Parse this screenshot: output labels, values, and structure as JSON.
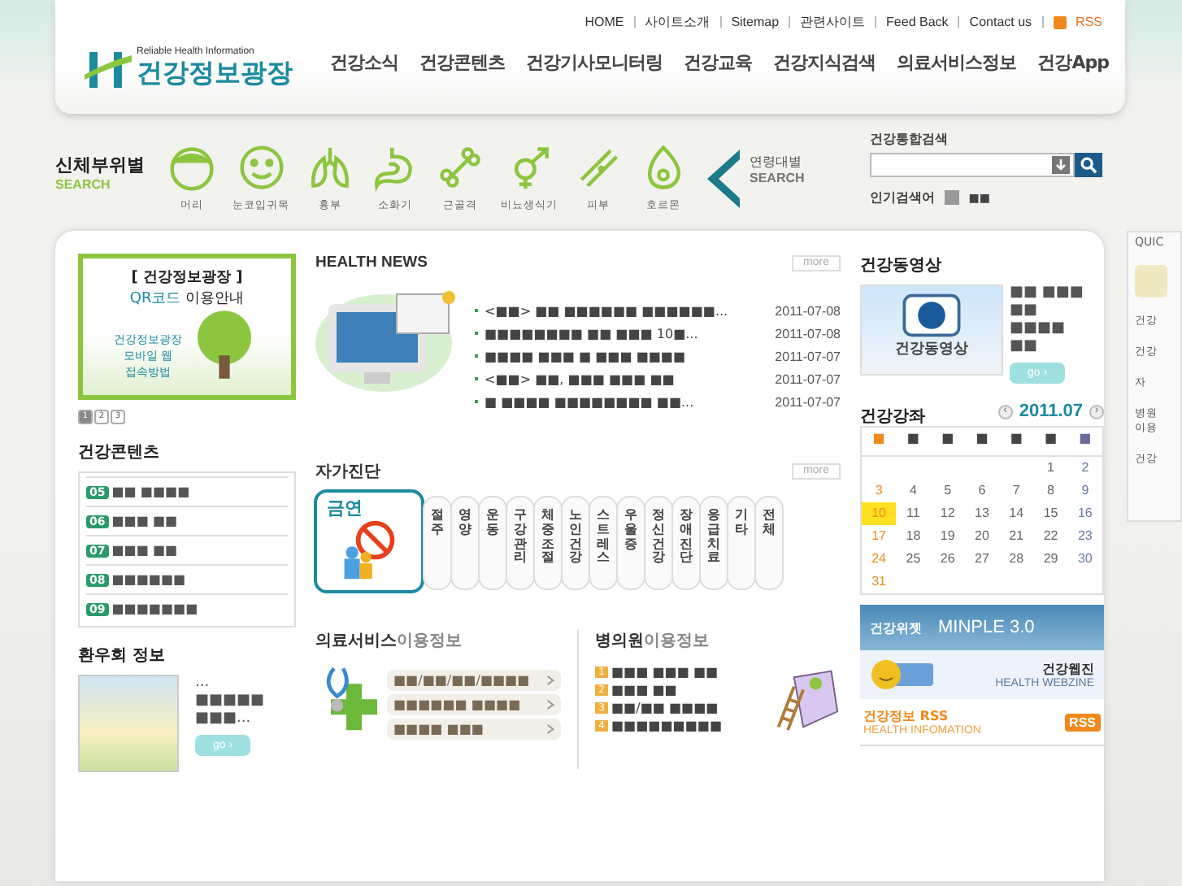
{
  "header": {
    "logo_tagline": "Reliable Health Information",
    "logo_title": "건강정보광장",
    "top_links": [
      "HOME",
      "사이트소개",
      "Sitemap",
      "관련사이트",
      "Feed Back",
      "Contact us"
    ],
    "rss_label": "RSS",
    "nav": [
      "건강소식",
      "건강콘텐츠",
      "건강기사모니터링",
      "건강교육",
      "건강지식검색",
      "의료서비스정보",
      "건강App"
    ]
  },
  "body_search": {
    "title": "신체부위별",
    "subtitle": "SEARCH",
    "parts": [
      {
        "kind": "head",
        "label": "머리"
      },
      {
        "kind": "face",
        "label": "눈코입귀목"
      },
      {
        "kind": "lungs",
        "label": "흉부"
      },
      {
        "kind": "stomach",
        "label": "소화기"
      },
      {
        "kind": "bone",
        "label": "근골격"
      },
      {
        "kind": "gender",
        "label": "비뇨생식기"
      },
      {
        "kind": "skin",
        "label": "피부"
      },
      {
        "kind": "drop",
        "label": "호르몬"
      }
    ],
    "age_title": "연령대별",
    "age_subtitle": "SEARCH"
  },
  "search": {
    "title": "건강통합검색",
    "popular_label": "인기검색어",
    "popular_value": "■■"
  },
  "banner": {
    "bracket_title": "[ 건강정보광장 ]",
    "qr_highlight": "QR코드",
    "qr_rest": "이용안내",
    "lines": [
      "건강정보광장",
      "모바일 웹",
      "접속방법"
    ],
    "pages": [
      {
        "label": "1",
        "selected": true
      },
      {
        "label": "2",
        "selected": false
      },
      {
        "label": "3",
        "selected": false
      }
    ]
  },
  "health_contents": {
    "title": "건강콘텐츠",
    "items": [
      {
        "number": "05",
        "text": "■■ ■■■■"
      },
      {
        "number": "06",
        "text": "■■■ ■■"
      },
      {
        "number": "07",
        "text": "■■■ ■■"
      },
      {
        "number": "08",
        "text": "■■■■■■"
      },
      {
        "number": "09",
        "text": "■■■■■■■"
      }
    ]
  },
  "patient_group": {
    "title": "환우회 정보",
    "text": "...\n■■■■■\n■■■...",
    "go": "go ›"
  },
  "health_news": {
    "title": "HEALTH NEWS",
    "more": "more",
    "items": [
      {
        "text": "<■■> ■■ ■■■■■■ ■■■■■■...",
        "date": "2011-07-08"
      },
      {
        "text": "■■■■■■■■ ■■ ■■■ 10■...",
        "date": "2011-07-08"
      },
      {
        "text": "■■■■ ■■■ ■ ■■■ ■■■■",
        "date": "2011-07-07"
      },
      {
        "text": "<■■> ■■, ■■■ ■■■ ■■",
        "date": "2011-07-07"
      },
      {
        "text": "■ ■■■■ ■■■■■■■■ ■■...",
        "date": "2011-07-07"
      }
    ]
  },
  "self_check": {
    "title": "자가진단",
    "more": "more",
    "tabs": [
      {
        "label": "금연",
        "selected": true
      },
      {
        "label": "절주",
        "selected": false
      },
      {
        "label": "영양",
        "selected": false
      },
      {
        "label": "운동",
        "selected": false
      },
      {
        "label": "구강관리",
        "selected": false
      },
      {
        "label": "체중조절",
        "selected": false
      },
      {
        "label": "노인건강",
        "selected": false
      },
      {
        "label": "스트레스",
        "selected": false
      },
      {
        "label": "우울증",
        "selected": false
      },
      {
        "label": "정신건강",
        "selected": false
      },
      {
        "label": "장애진단",
        "selected": false
      },
      {
        "label": "응급치료",
        "selected": false
      },
      {
        "label": "기타",
        "selected": false
      },
      {
        "label": "전체",
        "selected": false
      }
    ]
  },
  "medical_service": {
    "title_bold": "의료서비스",
    "title_rest": "이용정보",
    "links": [
      "■■/■■/■■/■■■■",
      "■■■■■■ ■■■■",
      "■■■■ ■■■"
    ]
  },
  "hospital_info": {
    "title_bold": "병의원",
    "title_rest": "이용정보",
    "items": [
      {
        "number": "1",
        "text": "■■■ ■■■ ■■"
      },
      {
        "number": "2",
        "text": "■■■ ■■"
      },
      {
        "number": "3",
        "text": "■■/■■ ■■■■"
      },
      {
        "number": "4",
        "text": "■■■■■■■■■"
      }
    ]
  },
  "health_video": {
    "title": "건강동영상",
    "thumb_caption": "건강동영상",
    "text": "■■ ■■■\n■■\n■■■■\n■■",
    "go": "go ›"
  },
  "lecture_calendar": {
    "title": "건강강좌",
    "prev": "‹",
    "month": "2011.07",
    "next": "›",
    "weekdays": [
      {
        "label": "■",
        "color": "#f08a1c"
      },
      {
        "label": "■",
        "color": "#444444"
      },
      {
        "label": "■",
        "color": "#444444"
      },
      {
        "label": "■",
        "color": "#444444"
      },
      {
        "label": "■",
        "color": "#444444"
      },
      {
        "label": "■",
        "color": "#444444"
      },
      {
        "label": "■",
        "color": "#6a6a9a"
      }
    ],
    "days": [
      {
        "kind": "blank"
      },
      {
        "kind": "blank"
      },
      {
        "kind": "blank"
      },
      {
        "kind": "blank"
      },
      {
        "kind": "blank"
      },
      {
        "kind": "day",
        "label": "1",
        "today": false
      },
      {
        "label": "2",
        "today": false
      },
      {
        "label": "3",
        "today": false
      },
      {
        "label": "4",
        "today": false
      },
      {
        "label": "5",
        "today": false
      },
      {
        "label": "6",
        "today": false
      },
      {
        "label": "7",
        "today": false
      },
      {
        "label": "8",
        "today": false
      },
      {
        "label": "9",
        "today": false
      },
      {
        "label": "10",
        "today": true
      },
      {
        "label": "11",
        "today": false
      },
      {
        "label": "12",
        "today": false
      },
      {
        "label": "13",
        "today": false
      },
      {
        "label": "14",
        "today": false
      },
      {
        "label": "15",
        "today": false
      },
      {
        "label": "16",
        "today": false
      },
      {
        "label": "17",
        "today": false
      },
      {
        "label": "18",
        "today": false
      },
      {
        "label": "19",
        "today": false
      },
      {
        "label": "20",
        "today": false
      },
      {
        "label": "21",
        "today": false
      },
      {
        "label": "22",
        "today": false
      },
      {
        "label": "23",
        "today": false
      },
      {
        "label": "24",
        "today": false
      },
      {
        "label": "25",
        "today": false
      },
      {
        "label": "26",
        "today": false
      },
      {
        "label": "27",
        "today": false
      },
      {
        "label": "28",
        "today": false
      },
      {
        "label": "29",
        "today": false
      },
      {
        "label": "30",
        "today": false
      },
      {
        "label": "31",
        "today": false
      }
    ]
  },
  "widget_banner": {
    "label": "건강위젯",
    "product": "MINPLE 3.0"
  },
  "webzine_banner": {
    "title": "건강웹진",
    "subtitle": "HEALTH WEBZINE"
  },
  "rss_banner": {
    "title": "건강정보 RSS",
    "subtitle": "HEALTH INFOMATION",
    "badge": "RSS"
  },
  "quick_menu": {
    "title": "QUIC",
    "items": [
      "건강",
      "건강",
      "자",
      "병원\n이용",
      "건강"
    ]
  }
}
